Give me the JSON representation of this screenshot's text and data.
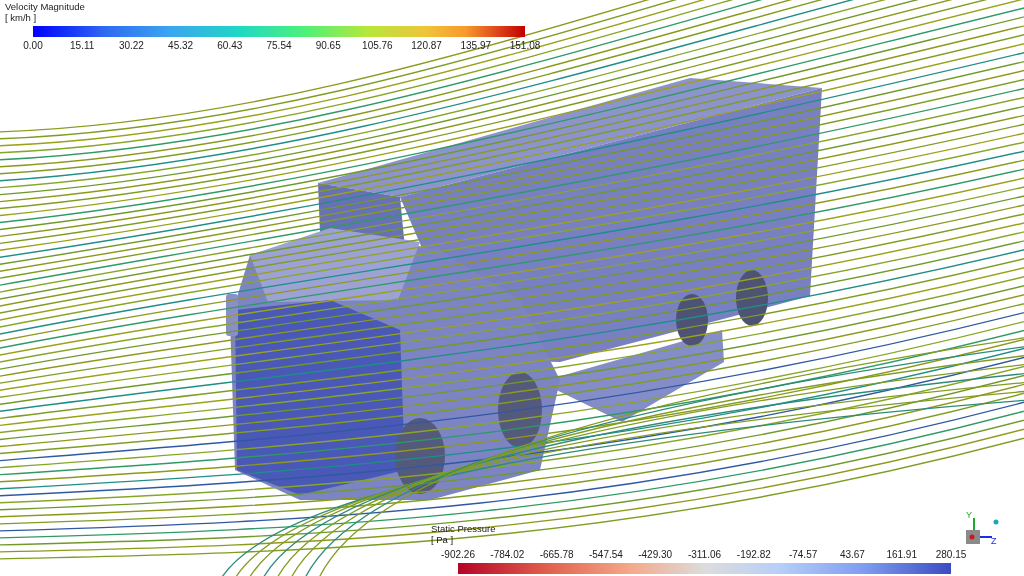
{
  "velocity_legend": {
    "kind": "rainbow",
    "title": "Velocity Magnitude",
    "unit": "[ km/h ]",
    "ticks": [
      "0.00",
      "15.11",
      "30.22",
      "45.32",
      "60.43",
      "75.54",
      "90.65",
      "105.76",
      "120.87",
      "135.97",
      "151.08"
    ]
  },
  "pressure_legend": {
    "kind": "cool_warm",
    "title": "Static Pressure",
    "unit": "[ Pa ]",
    "ticks": [
      "-902.26",
      "-784.02",
      "-665.78",
      "-547.54",
      "-429.30",
      "-311.06",
      "-192.82",
      "-74.57",
      "43.67",
      "161.91",
      "280.15"
    ]
  },
  "axis_triad": {
    "axes": [
      {
        "kind": "y",
        "label": "Y"
      },
      {
        "kind": "z",
        "label": "Z"
      }
    ]
  }
}
